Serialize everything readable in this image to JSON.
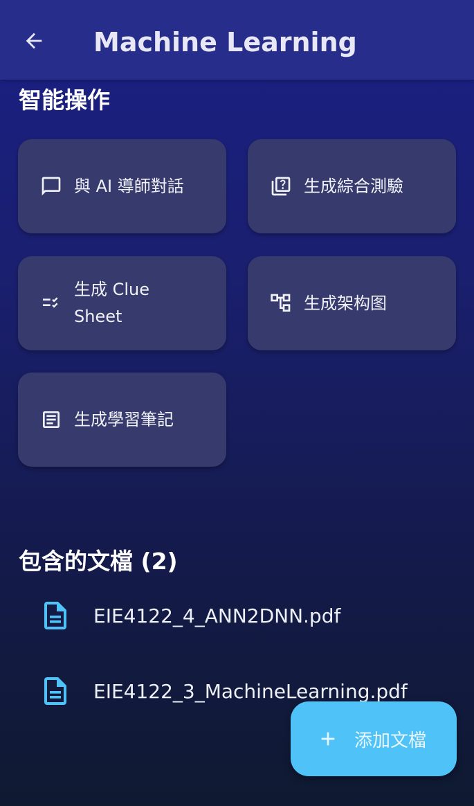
{
  "app_bar": {
    "title": "Machine Learning",
    "back_icon": "arrow-left-icon"
  },
  "smart_actions": {
    "title": "智能操作",
    "items": [
      {
        "label": "與 AI 導師對話",
        "icon": "chat-bubble-icon"
      },
      {
        "label": "生成綜合測驗",
        "icon": "quiz-icon"
      },
      {
        "label": "生成 Clue Sheet",
        "icon": "checklist-icon"
      },
      {
        "label": "生成架构图",
        "icon": "diagram-icon"
      },
      {
        "label": "生成學習筆記",
        "icon": "notes-icon"
      }
    ]
  },
  "documents": {
    "title": "包含的文檔 (2)",
    "items": [
      {
        "name": "EIE4122_4_ANN2DNN.pdf",
        "icon": "document-icon"
      },
      {
        "name": "EIE4122_3_MachineLearning.pdf",
        "icon": "document-icon"
      }
    ]
  },
  "fab": {
    "label": "添加文檔",
    "icon": "plus-icon"
  },
  "colors": {
    "app_bar": "#272d8a",
    "card": "#373a6c",
    "accent": "#4fc3f7",
    "doc_icon": "#4fc3f7"
  }
}
